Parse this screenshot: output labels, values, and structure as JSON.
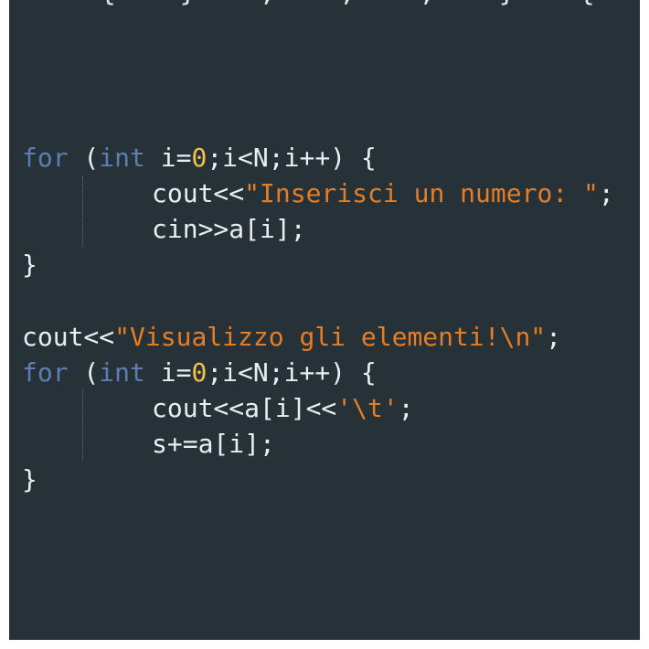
{
  "editor": {
    "top_fragment": "     {    }    ,    ;    ,    }    {",
    "lines": [
      {
        "id": "for1",
        "tokens": [
          {
            "t": "for",
            "c": "kw"
          },
          {
            "t": " (",
            "c": "plain"
          },
          {
            "t": "int",
            "c": "kw"
          },
          {
            "t": " i=",
            "c": "plain"
          },
          {
            "t": "0",
            "c": "num"
          },
          {
            "t": ";i<N;i++) {",
            "c": "plain"
          }
        ]
      },
      {
        "id": "cout1",
        "indent": true,
        "tokens": [
          {
            "t": "cout<<",
            "c": "plain"
          },
          {
            "t": "\"Inserisci un numero: \"",
            "c": "str"
          },
          {
            "t": ";",
            "c": "plain"
          }
        ]
      },
      {
        "id": "cin1",
        "indent": true,
        "tokens": [
          {
            "t": "cin>>a[i];",
            "c": "plain"
          }
        ]
      },
      {
        "id": "close1",
        "tokens": [
          {
            "t": "}",
            "c": "plain"
          }
        ]
      },
      {
        "id": "blank1",
        "blank": true,
        "tokens": []
      },
      {
        "id": "cout2",
        "tokens": [
          {
            "t": "cout<<",
            "c": "plain"
          },
          {
            "t": "\"Visualizzo gli elementi!\\n\"",
            "c": "str"
          },
          {
            "t": ";",
            "c": "plain"
          }
        ]
      },
      {
        "id": "for2",
        "tokens": [
          {
            "t": "for",
            "c": "kw"
          },
          {
            "t": " (",
            "c": "plain"
          },
          {
            "t": "int",
            "c": "kw"
          },
          {
            "t": " i=",
            "c": "plain"
          },
          {
            "t": "0",
            "c": "num"
          },
          {
            "t": ";i<N;i++) {",
            "c": "plain"
          }
        ]
      },
      {
        "id": "cout3",
        "indent": true,
        "tokens": [
          {
            "t": "cout<<a[i]<<",
            "c": "plain"
          },
          {
            "t": "'\\t'",
            "c": "str"
          },
          {
            "t": ";",
            "c": "plain"
          }
        ]
      },
      {
        "id": "sum1",
        "indent": true,
        "tokens": [
          {
            "t": "s+=a[i];",
            "c": "plain"
          }
        ]
      },
      {
        "id": "close2",
        "tokens": [
          {
            "t": "}",
            "c": "plain"
          }
        ]
      }
    ]
  },
  "colors": {
    "background": "#263238",
    "keyword": "#5b7fb3",
    "string": "#e57d27",
    "number": "#f0c24c",
    "text": "#e9eef0"
  }
}
